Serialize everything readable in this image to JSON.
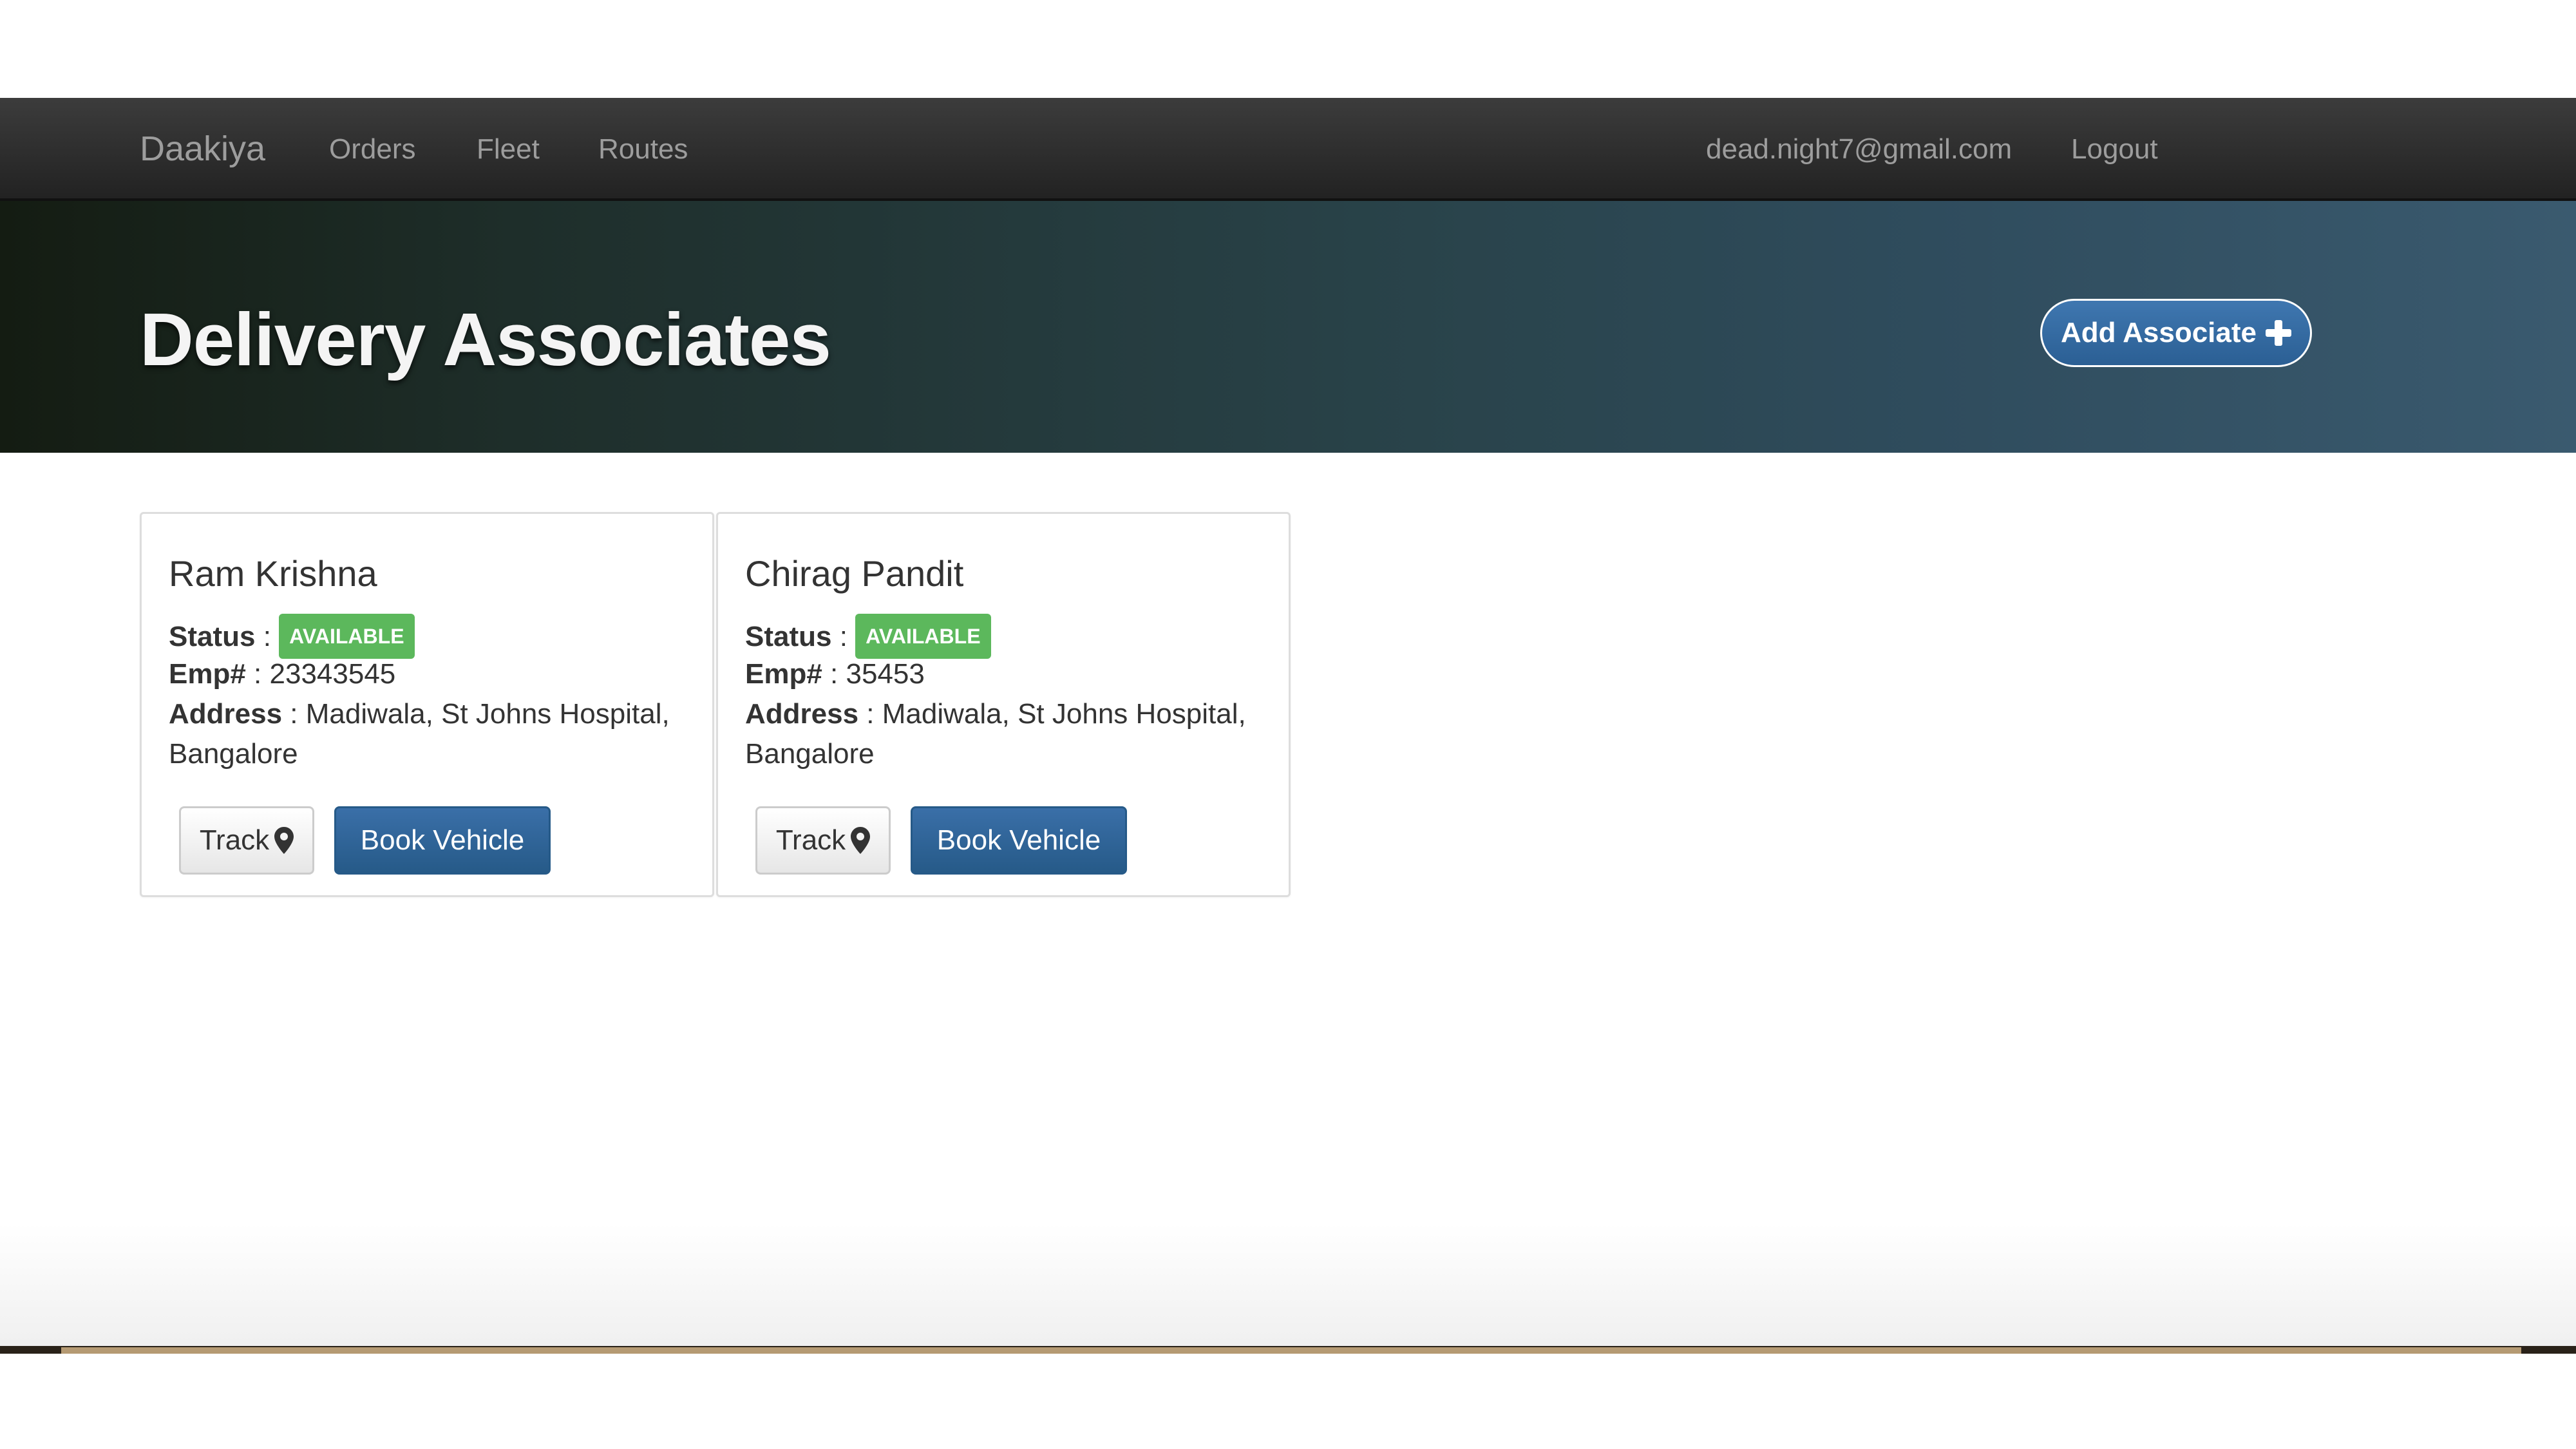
{
  "navbar": {
    "brand": "Daakiya",
    "links": [
      "Orders",
      "Fleet",
      "Routes"
    ],
    "user_email": "dead.night7@gmail.com",
    "logout": "Logout"
  },
  "hero": {
    "title": "Delivery Associates",
    "add_button": "Add Associate",
    "add_icon": "plus-icon"
  },
  "labels": {
    "status": "Status",
    "emp": "Emp#",
    "address": "Address",
    "separator": " : "
  },
  "associates": [
    {
      "name": "Ram Krishna",
      "status": "AVAILABLE",
      "emp": "23343545",
      "address": "Madiwala, St Johns Hospital, Bangalore",
      "track_label": "Track",
      "book_label": "Book Vehicle"
    },
    {
      "name": "Chirag Pandit",
      "status": "AVAILABLE",
      "emp": "35453",
      "address": "Madiwala, St Johns Hospital, Bangalore",
      "track_label": "Track",
      "book_label": "Book Vehicle"
    }
  ],
  "colors": {
    "navbar_bg": "#222222",
    "badge_available": "#5cb85c",
    "primary_button": "#2b5f94"
  }
}
